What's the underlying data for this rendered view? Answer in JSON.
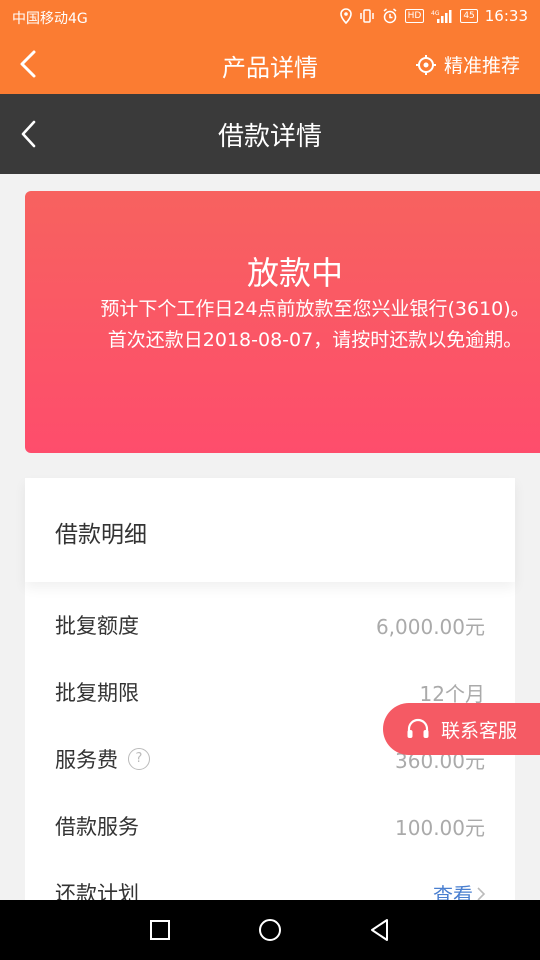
{
  "status_bar": {
    "carrier": "中国移动4G",
    "icons": [
      "location-icon",
      "vibrate-icon",
      "alarm-icon",
      "hd-icon",
      "signal-icon",
      "battery-icon"
    ],
    "hd_label": "HD",
    "battery_level": "45",
    "time": "16:33"
  },
  "app_bar": {
    "title": "产品详情",
    "recommend_label": "精准推荐",
    "color": "#fb7c32"
  },
  "sub_bar": {
    "title": "借款详情",
    "color": "#3a3a3a"
  },
  "status_card": {
    "heading": "放款中",
    "description": "预计下个工作日24点前放款至您兴业银行(3610)。首次还款日2018-08-07，请按时还款以免逾期。",
    "gradient_from": "#f7625f",
    "gradient_to": "#fe4d6c"
  },
  "detail": {
    "title": "借款明细",
    "rows": [
      {
        "label": "批复额度",
        "value": "6,000.00元"
      },
      {
        "label": "批复期限",
        "value": "12个月"
      },
      {
        "label": "服务费",
        "value": "360.00元",
        "help": "?"
      },
      {
        "label": "借款服务",
        "value": "100.00元"
      },
      {
        "label": "还款计划",
        "link": "查看"
      }
    ]
  },
  "customer_service": {
    "label": "联系客服"
  }
}
